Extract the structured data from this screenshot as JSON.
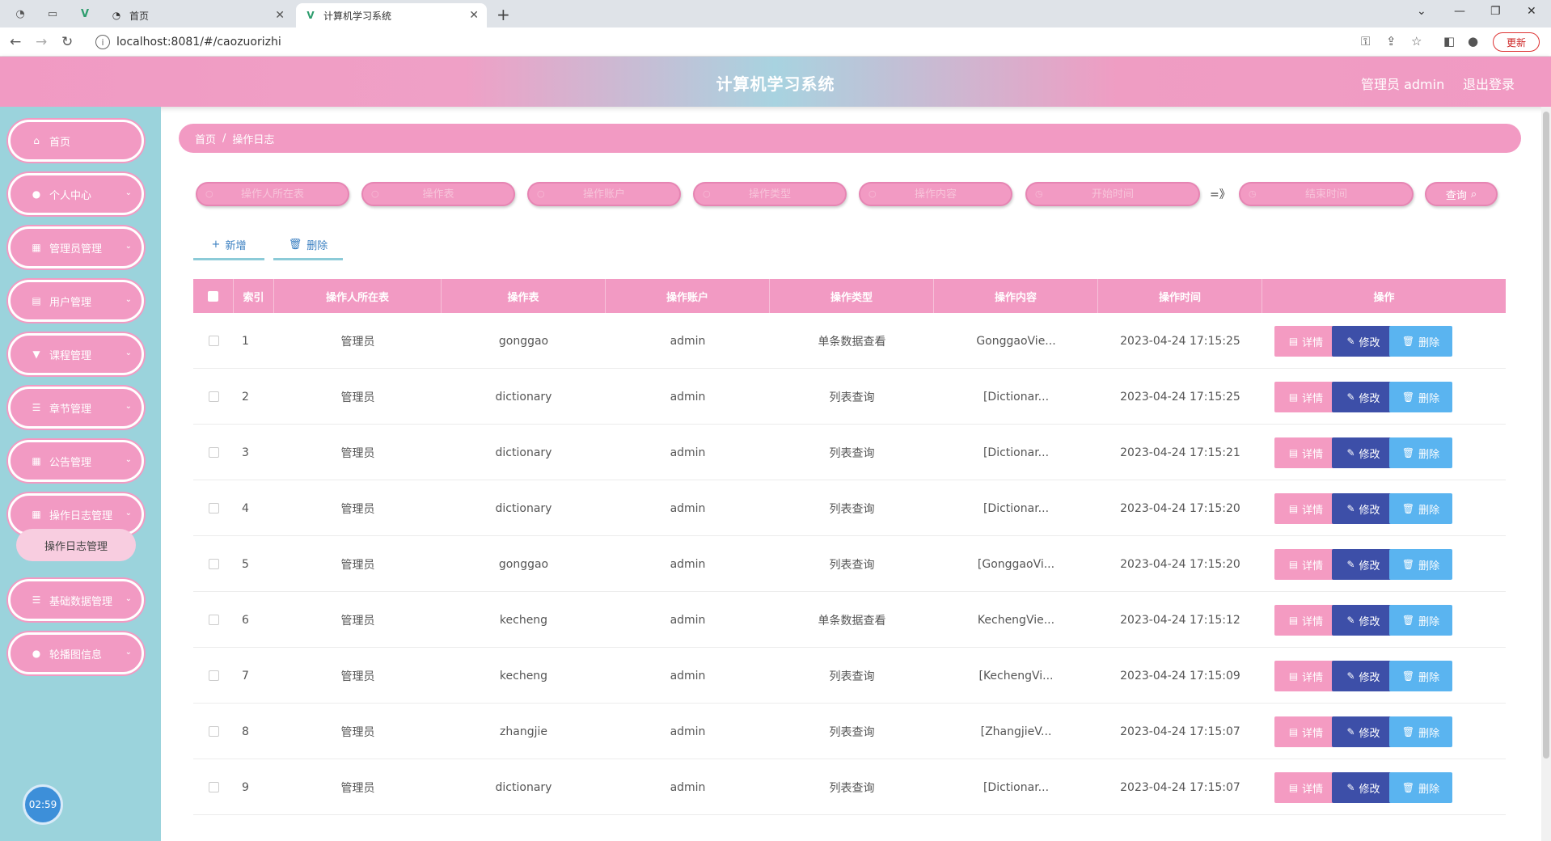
{
  "browser": {
    "tabs": [
      {
        "title": "首页",
        "active": false
      },
      {
        "title": "计算机学习系统",
        "active": true
      }
    ],
    "url": "localhost:8081/#/caozuorizhi",
    "update_label": "更新"
  },
  "header": {
    "title": "计算机学习系统",
    "user": "管理员 admin",
    "logout": "退出登录"
  },
  "sidebar": {
    "items": [
      {
        "label": "首页",
        "icon": "home-icon",
        "glyph": "⌂",
        "arrow": false
      },
      {
        "label": "个人中心",
        "icon": "user-icon",
        "glyph": "●",
        "arrow": true
      },
      {
        "label": "管理员管理",
        "icon": "grid-icon",
        "glyph": "▦",
        "arrow": true
      },
      {
        "label": "用户管理",
        "icon": "clipboard-icon",
        "glyph": "▤",
        "arrow": true
      },
      {
        "label": "课程管理",
        "icon": "cup-icon",
        "glyph": "▼",
        "arrow": true
      },
      {
        "label": "章节管理",
        "icon": "list-icon",
        "glyph": "☰",
        "arrow": true
      },
      {
        "label": "公告管理",
        "icon": "apps-icon",
        "glyph": "▦",
        "arrow": true
      },
      {
        "label": "操作日志管理",
        "icon": "grid-icon",
        "glyph": "▦",
        "arrow": true
      },
      {
        "label": "基础数据管理",
        "icon": "list-icon",
        "glyph": "☰",
        "arrow": true
      },
      {
        "label": "轮播图信息",
        "icon": "bulb-icon",
        "glyph": "●",
        "arrow": true
      }
    ],
    "submenu_label": "操作日志管理",
    "clock": "02:59"
  },
  "breadcrumb": {
    "home": "首页",
    "sep": "/",
    "current": "操作日志"
  },
  "search": {
    "fields": [
      {
        "name": "table-name",
        "placeholder": "操作人所在表"
      },
      {
        "name": "operation-table",
        "placeholder": "操作表"
      },
      {
        "name": "operation-account",
        "placeholder": "操作账户"
      },
      {
        "name": "operation-type",
        "placeholder": "操作类型"
      },
      {
        "name": "operation-content",
        "placeholder": "操作内容"
      },
      {
        "name": "start-time",
        "placeholder": "开始时间"
      },
      {
        "name": "end-time",
        "placeholder": "结束时间"
      }
    ],
    "range_sep": "=》",
    "query_label": "查询"
  },
  "actions": {
    "add_label": "新增",
    "delete_label": "删除"
  },
  "table": {
    "headers": [
      "索引",
      "操作人所在表",
      "操作表",
      "操作账户",
      "操作类型",
      "操作内容",
      "操作时间",
      "操作"
    ],
    "buttons": {
      "detail": "详情",
      "edit": "修改",
      "delete": "删除"
    },
    "rows": [
      {
        "index": "1",
        "who": "管理员",
        "table": "gonggao",
        "account": "admin",
        "type": "单条数据查看",
        "content": "GonggaoVie...",
        "time": "2023-04-24 17:15:25"
      },
      {
        "index": "2",
        "who": "管理员",
        "table": "dictionary",
        "account": "admin",
        "type": "列表查询",
        "content": "[Dictionar...",
        "time": "2023-04-24 17:15:25"
      },
      {
        "index": "3",
        "who": "管理员",
        "table": "dictionary",
        "account": "admin",
        "type": "列表查询",
        "content": "[Dictionar...",
        "time": "2023-04-24 17:15:21"
      },
      {
        "index": "4",
        "who": "管理员",
        "table": "dictionary",
        "account": "admin",
        "type": "列表查询",
        "content": "[Dictionar...",
        "time": "2023-04-24 17:15:20"
      },
      {
        "index": "5",
        "who": "管理员",
        "table": "gonggao",
        "account": "admin",
        "type": "列表查询",
        "content": "[GonggaoVi...",
        "time": "2023-04-24 17:15:20"
      },
      {
        "index": "6",
        "who": "管理员",
        "table": "kecheng",
        "account": "admin",
        "type": "单条数据查看",
        "content": "KechengVie...",
        "time": "2023-04-24 17:15:12"
      },
      {
        "index": "7",
        "who": "管理员",
        "table": "kecheng",
        "account": "admin",
        "type": "列表查询",
        "content": "[KechengVi...",
        "time": "2023-04-24 17:15:09"
      },
      {
        "index": "8",
        "who": "管理员",
        "table": "zhangjie",
        "account": "admin",
        "type": "列表查询",
        "content": "[ZhangjieV...",
        "time": "2023-04-24 17:15:07"
      },
      {
        "index": "9",
        "who": "管理员",
        "table": "dictionary",
        "account": "admin",
        "type": "列表查询",
        "content": "[Dictionar...",
        "time": "2023-04-24 17:15:07"
      }
    ]
  }
}
